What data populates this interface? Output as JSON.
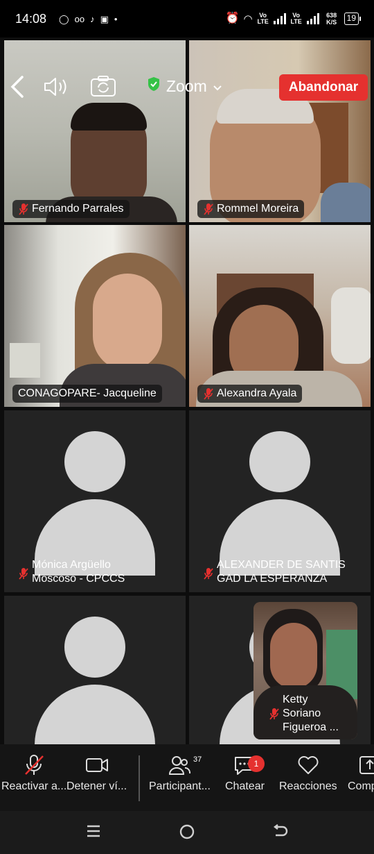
{
  "status_bar": {
    "time": "14:08",
    "network_1": "Vo LTE",
    "network_2": "Vo LTE",
    "speed": "638 K/S",
    "battery": "19"
  },
  "meeting": {
    "app_name": "Zoom",
    "leave_label": "Abandonar"
  },
  "participants": [
    {
      "name": "Fernando Parrales",
      "muted": true,
      "video": true
    },
    {
      "name": "Rommel Moreira",
      "muted": true,
      "video": true
    },
    {
      "name": "CONAGOPARE- Jacqueline",
      "muted": false,
      "video": true,
      "active_speaker": true
    },
    {
      "name": "Alexandra Ayala",
      "muted": true,
      "video": true
    },
    {
      "name": "Mónica Argüello Moscoso - CPCCS",
      "muted": true,
      "video": false
    },
    {
      "name": "ALEXANDER DE SANTIS GAD LA ESPERANZA",
      "muted": true,
      "video": false
    },
    {
      "name": "",
      "muted": false,
      "video": false
    },
    {
      "name": "",
      "muted": false,
      "video": false
    }
  ],
  "self_view": {
    "name": "Ketty Soriano Figueroa ...",
    "muted": true
  },
  "toolbar": {
    "unmute_label": "Reactivar a...",
    "stop_video_label": "Detener ví...",
    "participants_label": "Participant...",
    "participants_count": "37",
    "chat_label": "Chatear",
    "chat_badge": "1",
    "reactions_label": "Reacciones",
    "share_label": "Comp"
  },
  "colors": {
    "leave_button": "#e5312f",
    "active_speaker_border": "#35c247",
    "avatar_placeholder": "#d4d4d4",
    "shield": "#35c247"
  }
}
